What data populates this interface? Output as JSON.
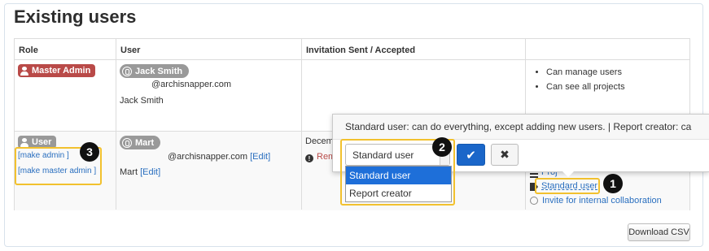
{
  "page": {
    "title": "Existing users"
  },
  "table": {
    "headers": [
      "Role",
      "User",
      "Invitation Sent / Accepted",
      ""
    ],
    "rows": [
      {
        "role_badge": "Master Admin",
        "user_name_pill": "Jack Smith",
        "user_email": "@archisnapper.com",
        "user_fullname": "Jack Smith",
        "permissions": [
          "Can manage users",
          "Can see all projects"
        ]
      },
      {
        "role_badge": "User",
        "make_admin": "[make admin ]",
        "make_master_admin": "[make master admin ]",
        "user_name_pill": "Mart",
        "user_email": "@archisnapper.com",
        "edit_email": "[Edit]",
        "user_fullname": "Mart",
        "edit_name": "[Edit]",
        "invitation_text": "Decem",
        "invitation_action": "Rem",
        "projects_link": "Proj",
        "role_link": "Standard user",
        "invite_link": "Invite for internal collaboration"
      }
    ]
  },
  "popover": {
    "title": "Standard user: can do everything, except adding new users. | Report creator: ca",
    "select_value": "Standard user",
    "options": [
      "Standard user",
      "Report creator"
    ],
    "selected_index": 0,
    "confirm_icon": "check-icon",
    "cancel_icon": "x-icon"
  },
  "callouts": [
    "1",
    "2",
    "3"
  ],
  "download_button": "Download CSV",
  "colors": {
    "master_admin": "#b94a48",
    "user_badge": "#999999",
    "primary": "#1a66c9",
    "highlight": "#f2c12e",
    "link": "#2a6fbf"
  }
}
